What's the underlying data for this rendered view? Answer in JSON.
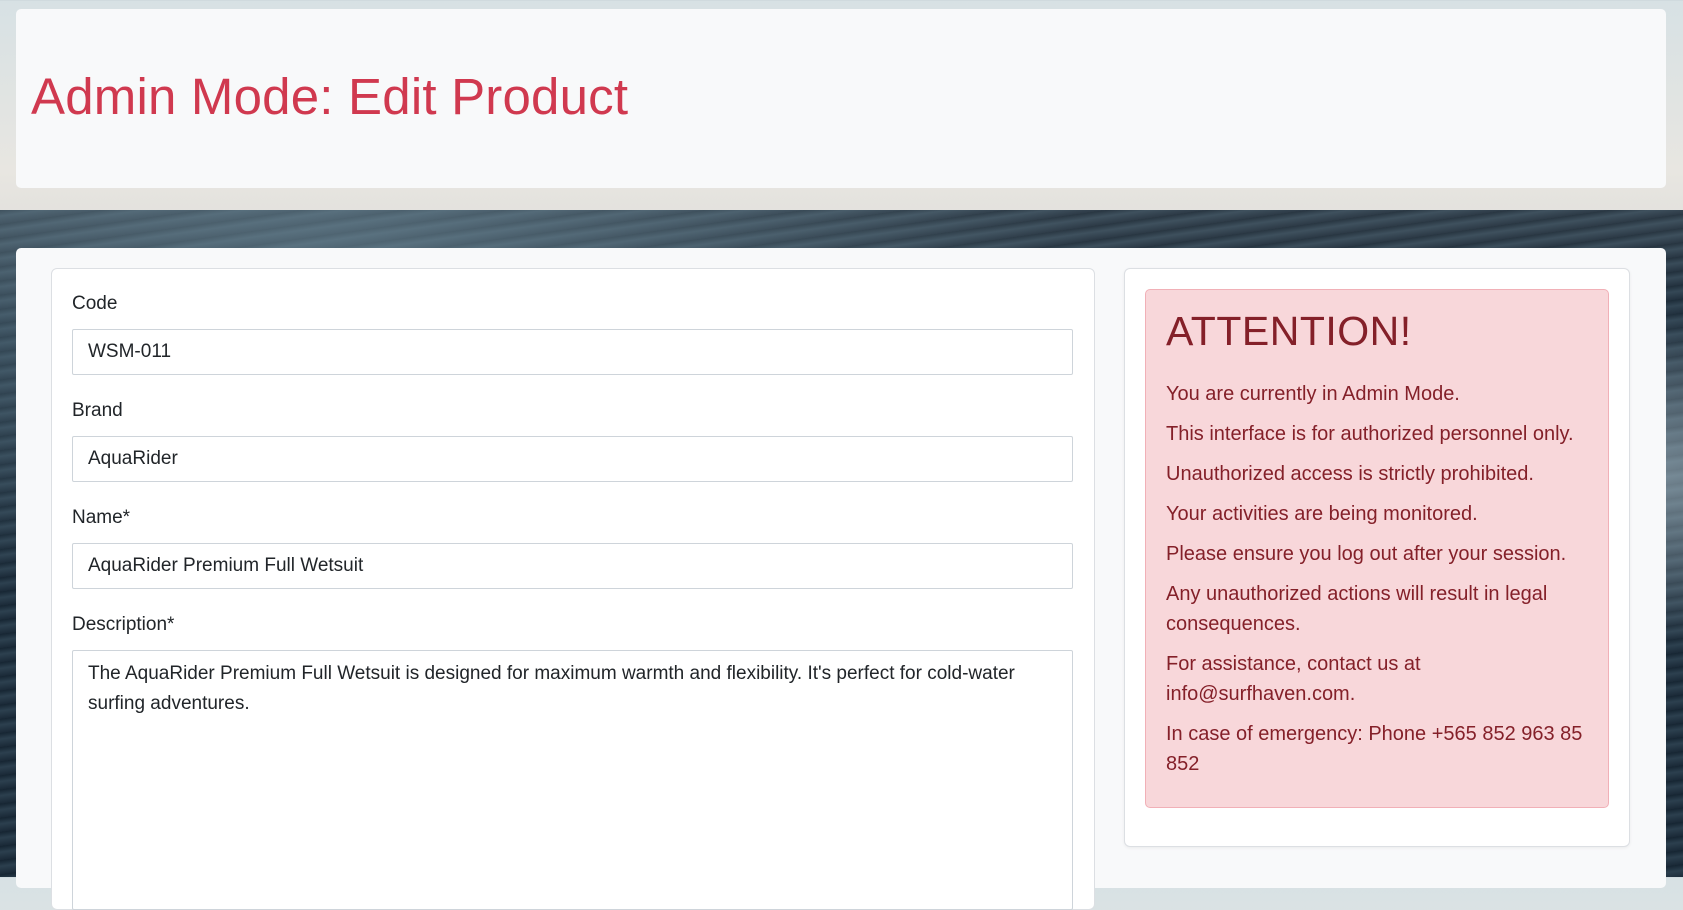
{
  "header": {
    "title": "Admin Mode: Edit Product"
  },
  "form": {
    "code": {
      "label": "Code",
      "value": "WSM-011"
    },
    "brand": {
      "label": "Brand",
      "value": "AquaRider"
    },
    "name": {
      "label": "Name*",
      "value": "AquaRider Premium Full Wetsuit"
    },
    "description": {
      "label": "Description*",
      "value": "The AquaRider Premium Full Wetsuit is designed for maximum warmth and flexibility. It's perfect for cold-water surfing adventures."
    }
  },
  "alert": {
    "heading": "ATTENTION!",
    "lines": [
      "You are currently in Admin Mode.",
      "This interface is for authorized personnel only.",
      "Unauthorized access is strictly prohibited.",
      "Your activities are being monitored.",
      "Please ensure you log out after your session.",
      "Any unauthorized actions will result in legal consequences.",
      "For assistance, contact us at info@surfhaven.com.",
      "In case of emergency: Phone +565 852 963 85 852"
    ]
  },
  "colors": {
    "title": "#d0394f",
    "alert_background": "#f8d7da",
    "alert_text": "#842029",
    "panel_background": "#f8f9fa"
  }
}
